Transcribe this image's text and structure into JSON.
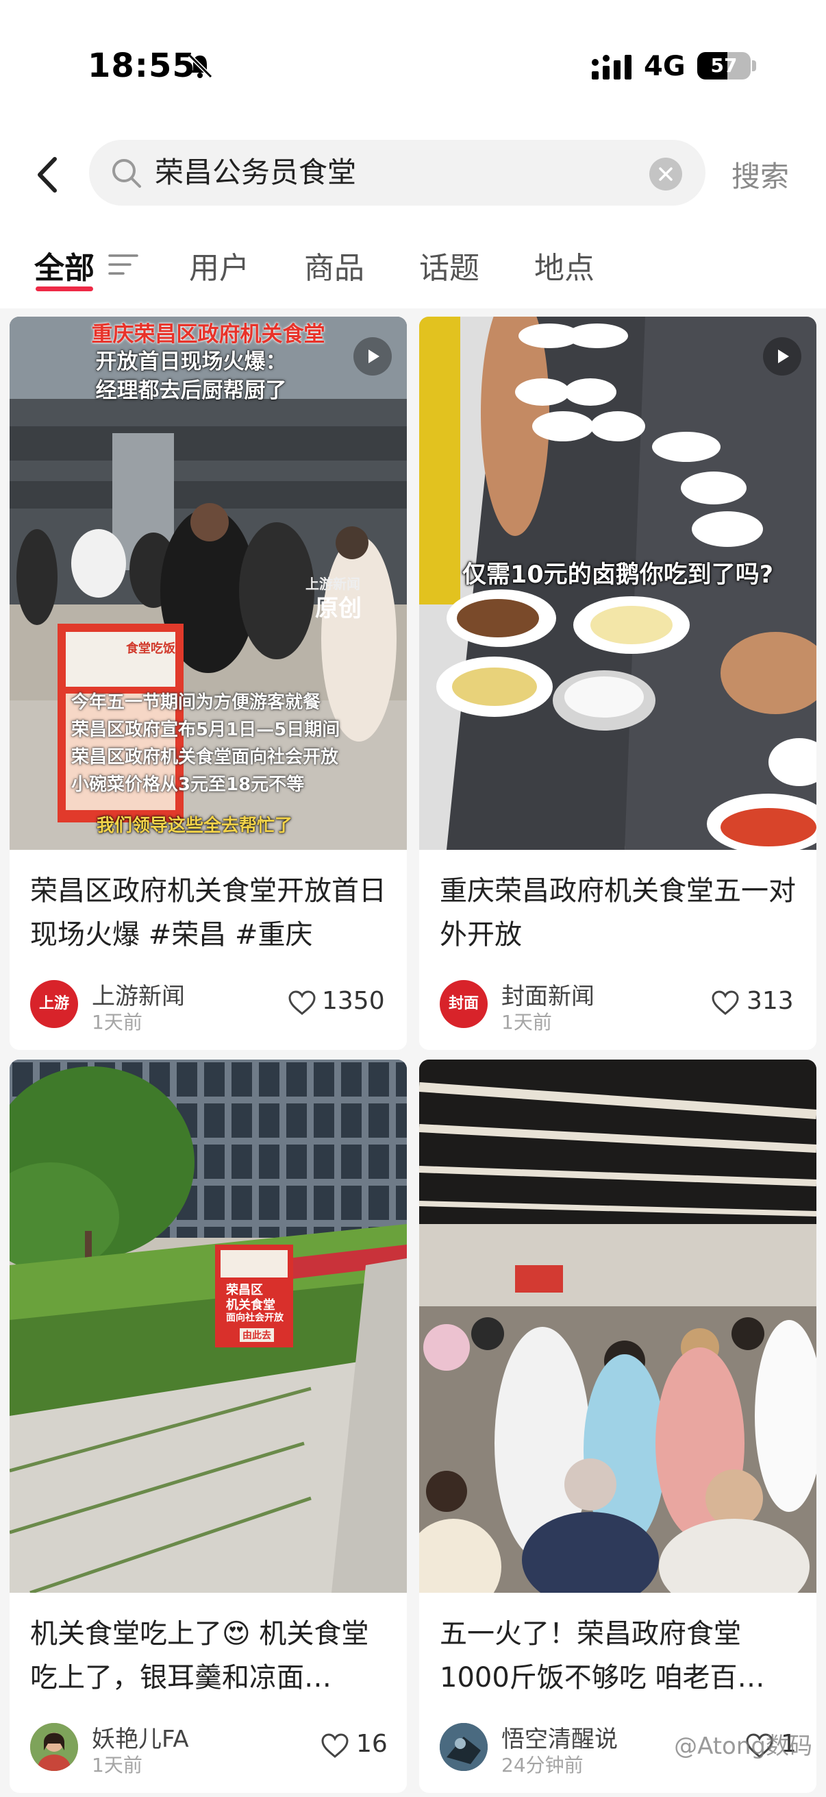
{
  "status_bar": {
    "time": "18:55",
    "network": "4G",
    "battery": "57",
    "battery_level": 0.57
  },
  "search": {
    "query": "荣昌公务员食堂",
    "search_button": "搜索"
  },
  "tabs": [
    {
      "label": "全部",
      "active": true
    },
    {
      "label": "用户"
    },
    {
      "label": "商品"
    },
    {
      "label": "话题"
    },
    {
      "label": "地点"
    }
  ],
  "cards": [
    {
      "overlay_title_line1": "重庆荣昌区政府机关食堂",
      "overlay_title_line2": "开放首日现场火爆：",
      "overlay_title_line3": "经理都去后厨帮厨了",
      "overlay_source": "上游新闻",
      "overlay_original": "原创",
      "sign_lines": [
        "今年五一节期间为方便游客就餐",
        "荣昌区政府宣布5月1日—5日期间",
        "荣昌区政府机关食堂面向社会开放",
        "小碗菜价格从3元至18元不等"
      ],
      "caption": "我们领导这些全去帮忙了",
      "sign_board": "食堂吃饭",
      "title": "荣昌区政府机关食堂开放首日现场火爆 #荣昌  #重庆",
      "author": "上游新闻",
      "avatar_text": "上游",
      "time": "1天前",
      "likes": "1350"
    },
    {
      "overlay_title": "仅需10元的卤鹅你吃到了吗?",
      "title": "重庆荣昌政府机关食堂五一对外开放",
      "author": "封面新闻",
      "avatar_text": "封面",
      "time": "1天前",
      "likes": "313"
    },
    {
      "sign_lines": [
        "荣昌区",
        "机关食堂",
        "面向社会开放",
        "由此去"
      ],
      "title": "机关食堂吃上了😍 机关食堂吃上了，银耳羹和凉面…",
      "author": "妖艳儿FA",
      "time": "1天前",
      "likes": "16"
    },
    {
      "title": "五一火了！荣昌政府食堂1000斤饭不够吃 咱老百…",
      "author": "悟空清醒说",
      "time": "24分钟前",
      "likes": "1"
    }
  ],
  "watermark": "@Atong数码",
  "colors": {
    "accent": "#ee2a46",
    "avatar_red": "#d8232a"
  }
}
